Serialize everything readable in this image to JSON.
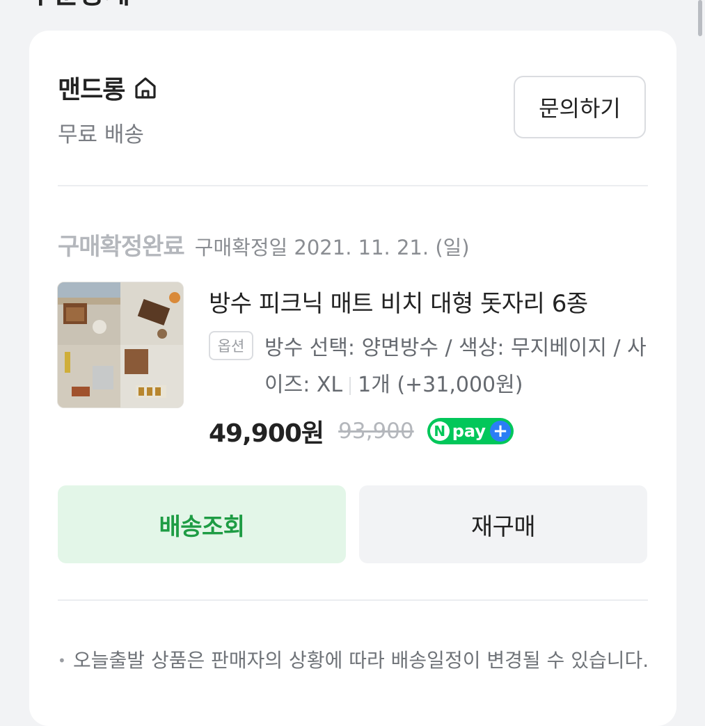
{
  "page": {
    "top_fragment": "주문상세"
  },
  "seller": {
    "name": "맨드롱",
    "delivery": "무료 배송",
    "inquiry_label": "문의하기"
  },
  "order": {
    "status": "구매확정완료",
    "confirm_date": "구매확정일 2021. 11. 21. (일)"
  },
  "product": {
    "title": "방수 피크닉 매트 비치 대형 돗자리 6종",
    "option_badge": "옵션",
    "option_text": "방수 선택: 양면방수 / 색상: 무지베이지 / 사이즈: XL",
    "quantity_price": "1개 (+31,000원)",
    "price": "49,900원",
    "original_price": "93,900",
    "pay_badge": {
      "n": "N",
      "label": "pay",
      "plus": "+"
    }
  },
  "actions": {
    "track_label": "배송조회",
    "rebuy_label": "재구매"
  },
  "notice": {
    "bullet": "•",
    "text": "오늘출발 상품은 판매자의 상황에 따라 배송일정이 변경될 수 있습니다."
  },
  "colors": {
    "track_button_bg": "#e3f6e8",
    "track_button_text": "#1e9c44",
    "npay_green": "#02c75a",
    "npay_plus_blue": "#2b7ef5",
    "card_bg": "#ffffff",
    "page_bg": "#f2f3f5"
  },
  "icons": {
    "seller_home": "home-icon"
  }
}
